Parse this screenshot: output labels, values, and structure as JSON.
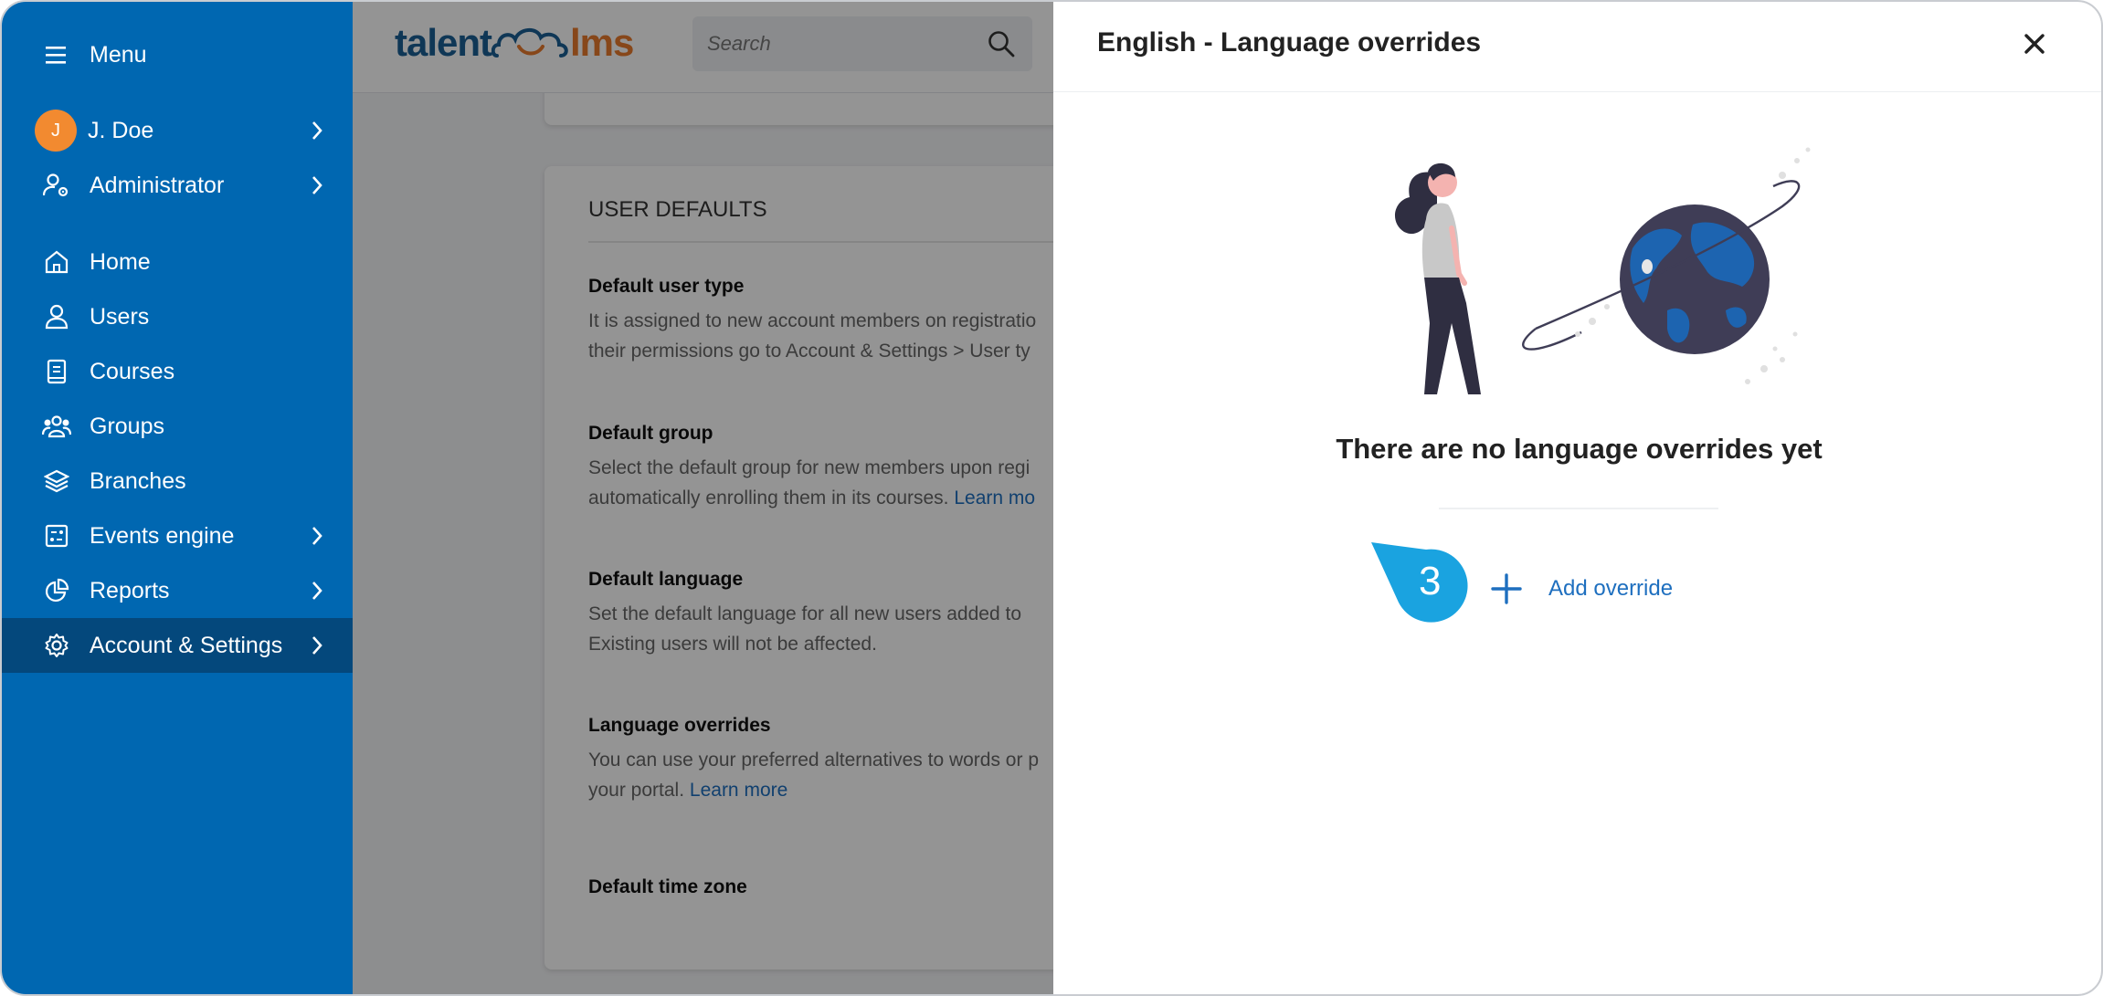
{
  "sidebar": {
    "menu_label": "Menu",
    "user": {
      "initial": "J",
      "name": "J. Doe"
    },
    "role": "Administrator",
    "items": [
      {
        "label": "Home",
        "icon": "home-icon"
      },
      {
        "label": "Users",
        "icon": "user-icon"
      },
      {
        "label": "Courses",
        "icon": "book-icon"
      },
      {
        "label": "Groups",
        "icon": "groups-icon"
      },
      {
        "label": "Branches",
        "icon": "layers-icon"
      },
      {
        "label": "Events engine",
        "icon": "events-icon"
      },
      {
        "label": "Reports",
        "icon": "pie-chart-icon"
      },
      {
        "label": "Account & Settings",
        "icon": "gear-icon"
      }
    ],
    "colors": {
      "background": "#0067b1",
      "active": "#04487c"
    }
  },
  "header": {
    "logo_part1": "talent",
    "logo_part2": "lms",
    "search_placeholder": "Search"
  },
  "settings": {
    "section_title": "USER DEFAULTS",
    "fields": [
      {
        "title": "Default user type",
        "line1": "It is assigned to new account members on registratio",
        "line2": "their permissions go to Account & Settings > User ty"
      },
      {
        "title": "Default group",
        "line1": "Select the default group for new members upon regi",
        "line2": "automatically enrolling them in its courses.",
        "link": "Learn mo"
      },
      {
        "title": "Default language",
        "line1": "Set the default language for all new users added to",
        "line2": "Existing users will not be affected."
      },
      {
        "title": "Language overrides",
        "line1": "You can use your preferred alternatives to words or p",
        "line2": "your portal.",
        "link": "Learn more"
      },
      {
        "title": "Default time zone"
      }
    ]
  },
  "panel": {
    "title": "English - Language overrides",
    "empty_message": "There are no language overrides yet",
    "add_label": "Add override"
  },
  "callout": {
    "step": "3",
    "color": "#1aa3e0"
  }
}
